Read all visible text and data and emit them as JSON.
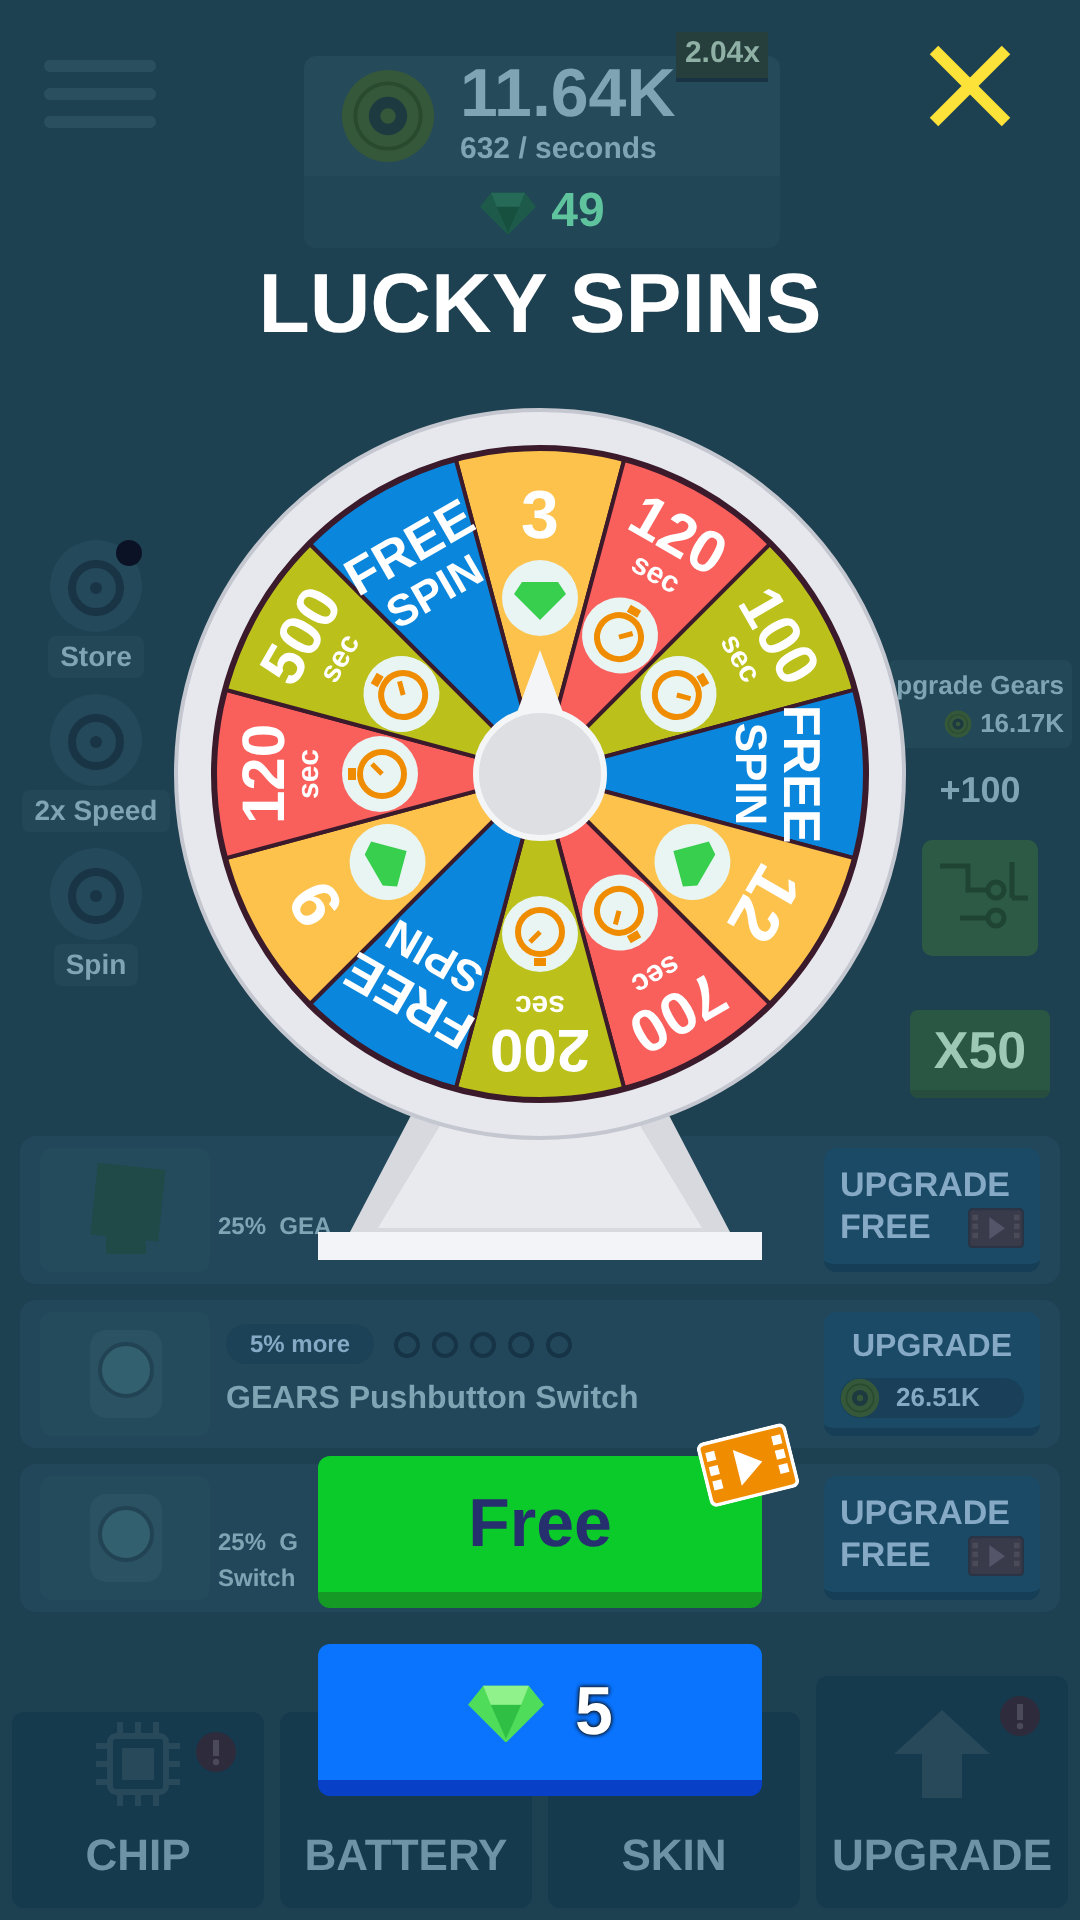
{
  "background": {
    "header": {
      "coins": "11.64K",
      "rate": "632 / seconds",
      "multiplier": "2.04x",
      "gems": "49"
    },
    "side_menu": [
      {
        "label": "Store",
        "notification": true
      },
      {
        "label": "2x Speed",
        "notification": false
      },
      {
        "label": "Spin",
        "notification": false
      }
    ],
    "upgrade_gears": {
      "label": "pgrade Gears",
      "cost": "16.17K",
      "bonus": "+100"
    },
    "bonus_card": "X50",
    "items": [
      {
        "kind": "ad",
        "title": "25%  GEA",
        "button": "UPGRADE",
        "price": "FREE"
      },
      {
        "kind": "coin",
        "tag": "5% more",
        "stars": 0,
        "title": "GEARS Pushbutton Switch",
        "button": "UPGRADE",
        "price": "26.51K"
      },
      {
        "kind": "ad",
        "title": "25%  G",
        "title_line2": "Switch",
        "button": "UPGRADE",
        "price": "FREE"
      }
    ],
    "tabs": [
      {
        "label": "CHIP",
        "alert": true
      },
      {
        "label": "BATTERY"
      },
      {
        "label": "SKIN"
      },
      {
        "label": "UPGRADE",
        "alert": true
      }
    ]
  },
  "modal": {
    "title": "LUCKY SPINS",
    "segments": [
      {
        "kind": "gems",
        "value": "3",
        "color": "#fcc24b"
      },
      {
        "kind": "time",
        "value": "120",
        "unit": "sec",
        "color": "#f95f5b"
      },
      {
        "kind": "time",
        "value": "100",
        "unit": "sec",
        "color": "#bcc01a"
      },
      {
        "kind": "free",
        "value": "FREE",
        "unit": "SPIN",
        "color": "#0a86dc"
      },
      {
        "kind": "gems",
        "value": "12",
        "color": "#fcc24b"
      },
      {
        "kind": "time",
        "value": "700",
        "unit": "sec",
        "color": "#f95f5b"
      },
      {
        "kind": "time",
        "value": "200",
        "unit": "sec",
        "color": "#bcc01a"
      },
      {
        "kind": "free",
        "value": "FREE",
        "unit": "SPIN",
        "color": "#0a86dc"
      },
      {
        "kind": "gems",
        "value": "9",
        "color": "#fcc24b"
      },
      {
        "kind": "time",
        "value": "120",
        "unit": "sec",
        "color": "#f95f5b"
      },
      {
        "kind": "time",
        "value": "500",
        "unit": "sec",
        "color": "#bcc01a"
      },
      {
        "kind": "free",
        "value": "FREE",
        "unit": "SPIN",
        "color": "#0a86dc"
      }
    ],
    "buttons": [
      {
        "kind": "ad",
        "label": "Free"
      },
      {
        "kind": "gems",
        "label": "5"
      }
    ]
  }
}
